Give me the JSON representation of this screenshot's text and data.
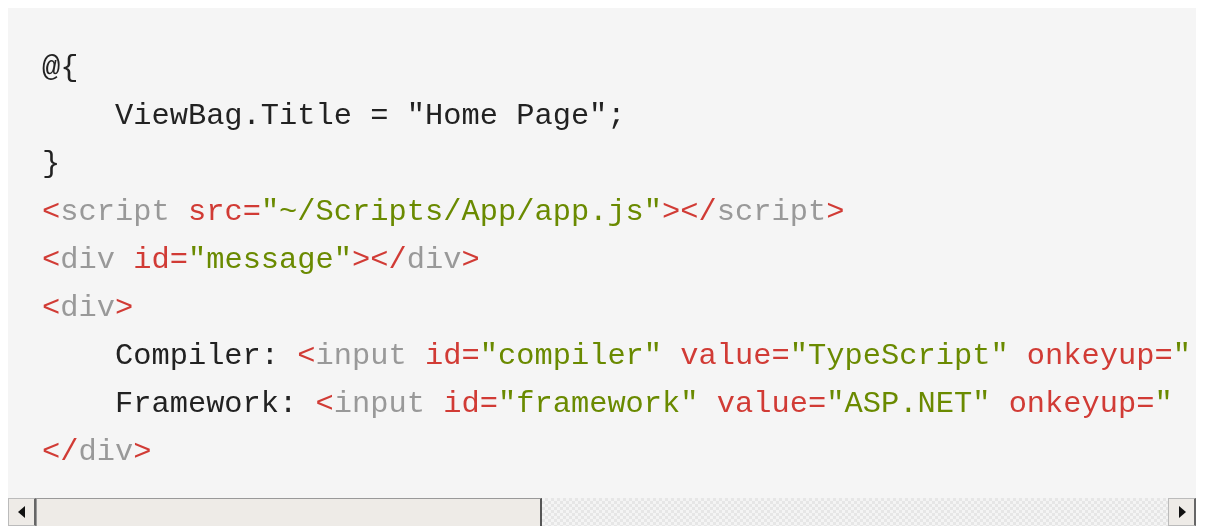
{
  "code_lines": [
    {
      "tokens": [
        {
          "kind": "plain",
          "text": "@{"
        }
      ]
    },
    {
      "tokens": [
        {
          "kind": "plain",
          "text": "    ViewBag.Title = \"Home Page\";"
        }
      ]
    },
    {
      "tokens": [
        {
          "kind": "plain",
          "text": "}"
        }
      ]
    },
    {
      "tokens": [
        {
          "kind": "punct",
          "text": "<"
        },
        {
          "kind": "tag",
          "text": "script"
        },
        {
          "kind": "attr",
          "text": " src="
        },
        {
          "kind": "string",
          "text": "\"~/Scripts/App/app.js\""
        },
        {
          "kind": "punct",
          "text": "></"
        },
        {
          "kind": "tag",
          "text": "script"
        },
        {
          "kind": "punct",
          "text": ">"
        }
      ]
    },
    {
      "tokens": [
        {
          "kind": "punct",
          "text": "<"
        },
        {
          "kind": "tag",
          "text": "div"
        },
        {
          "kind": "attr",
          "text": " id="
        },
        {
          "kind": "string",
          "text": "\"message\""
        },
        {
          "kind": "punct",
          "text": "></"
        },
        {
          "kind": "tag",
          "text": "div"
        },
        {
          "kind": "punct",
          "text": ">"
        }
      ]
    },
    {
      "tokens": [
        {
          "kind": "punct",
          "text": "<"
        },
        {
          "kind": "tag",
          "text": "div"
        },
        {
          "kind": "punct",
          "text": ">"
        }
      ]
    },
    {
      "tokens": [
        {
          "kind": "plain",
          "text": "    Compiler: "
        },
        {
          "kind": "punct",
          "text": "<"
        },
        {
          "kind": "tag",
          "text": "input"
        },
        {
          "kind": "attr",
          "text": " id="
        },
        {
          "kind": "string",
          "text": "\"compiler\""
        },
        {
          "kind": "attr",
          "text": " value="
        },
        {
          "kind": "string",
          "text": "\"TypeScript\""
        },
        {
          "kind": "attr",
          "text": " onkeyup="
        },
        {
          "kind": "string",
          "text": "\""
        }
      ]
    },
    {
      "tokens": [
        {
          "kind": "plain",
          "text": "    Framework: "
        },
        {
          "kind": "punct",
          "text": "<"
        },
        {
          "kind": "tag",
          "text": "input"
        },
        {
          "kind": "attr",
          "text": " id="
        },
        {
          "kind": "string",
          "text": "\"framework\""
        },
        {
          "kind": "attr",
          "text": " value="
        },
        {
          "kind": "string",
          "text": "\"ASP.NET\""
        },
        {
          "kind": "attr",
          "text": " onkeyup="
        },
        {
          "kind": "string",
          "text": "\""
        }
      ]
    },
    {
      "tokens": [
        {
          "kind": "punct",
          "text": "</"
        },
        {
          "kind": "tag",
          "text": "div"
        },
        {
          "kind": "punct",
          "text": ">"
        }
      ]
    }
  ]
}
